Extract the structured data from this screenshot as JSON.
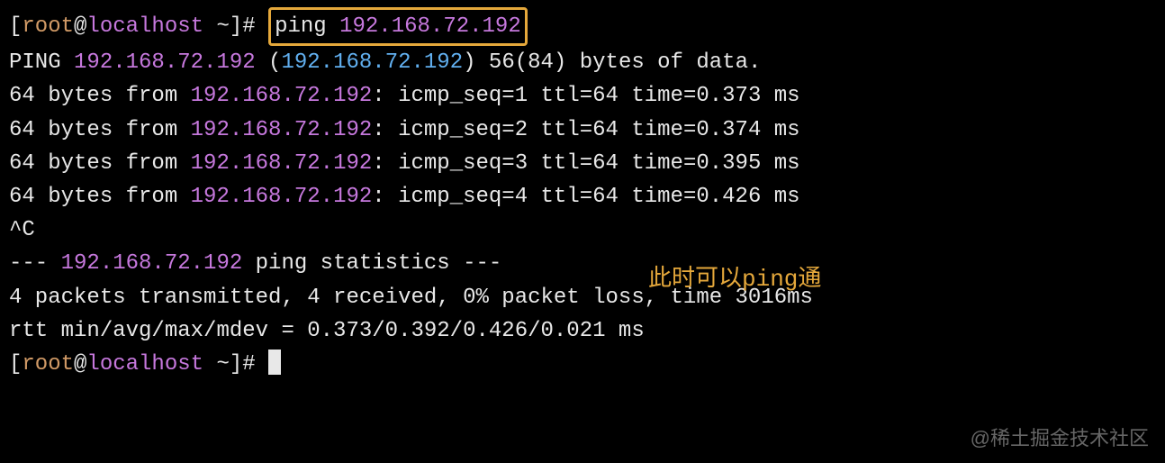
{
  "prompt": {
    "bracket_open": "[",
    "user": "root",
    "at": "@",
    "host": "localhost",
    "path": " ~",
    "bracket_close": "]",
    "symbol": "# "
  },
  "command": {
    "ping": "ping ",
    "ip": "192.168.72.192"
  },
  "output": {
    "header_prefix": "PING ",
    "header_ip1": "192.168.72.192",
    "header_paren_open": " (",
    "header_ip2": "192.168.72.192",
    "header_paren_close": ") ",
    "header_bytes": "56(84) bytes of data.",
    "replies": [
      {
        "prefix": "64 bytes from ",
        "ip": "192.168.72.192",
        "suffix": ": icmp_seq=1 ttl=64 time=0.373 ms"
      },
      {
        "prefix": "64 bytes from ",
        "ip": "192.168.72.192",
        "suffix": ": icmp_seq=2 ttl=64 time=0.374 ms"
      },
      {
        "prefix": "64 bytes from ",
        "ip": "192.168.72.192",
        "suffix": ": icmp_seq=3 ttl=64 time=0.395 ms"
      },
      {
        "prefix": "64 bytes from ",
        "ip": "192.168.72.192",
        "suffix": ": icmp_seq=4 ttl=64 time=0.426 ms"
      }
    ],
    "interrupt": "^C",
    "stats_prefix": "--- ",
    "stats_ip": "192.168.72.192",
    "stats_suffix": " ping statistics ---",
    "summary1": "4 packets transmitted, 4 received, 0% packet loss, time 3016ms",
    "summary2": "rtt min/avg/max/mdev = 0.373/0.392/0.426/0.021 ms"
  },
  "annotation": "此时可以ping通",
  "watermark": "@稀土掘金技术社区"
}
